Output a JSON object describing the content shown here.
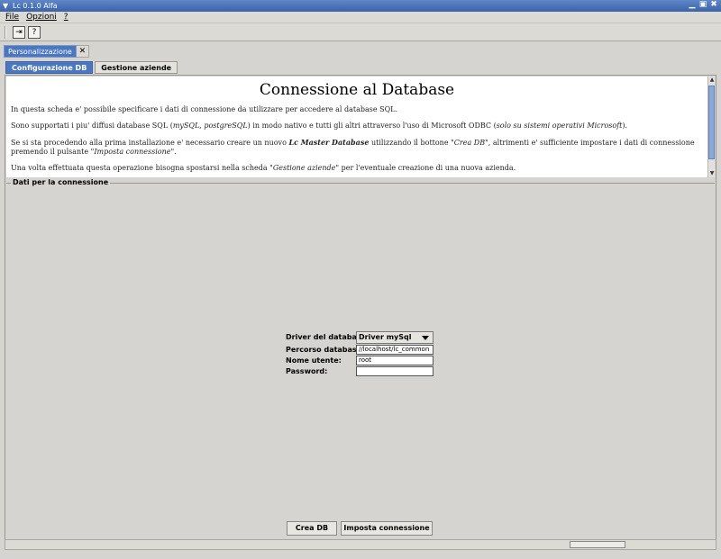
{
  "window": {
    "title": "Lc 0.1.0 Alfa"
  },
  "menu": {
    "file": "File",
    "opzioni": "Opzioni",
    "help": "?"
  },
  "toolbar": {
    "icon1": "new-window-icon",
    "icon2": "help-icon"
  },
  "outer_tab": {
    "label": "Personalizzazione",
    "close": "✕"
  },
  "inner_tabs": [
    {
      "label": "Configurazione DB",
      "active": true
    },
    {
      "label": "Gestione aziende",
      "active": false
    }
  ],
  "info": {
    "title": "Connessione al Database",
    "p1": "In questa scheda e' possibile specificare i dati di connessione da utilizzare per accedere al database SQL.",
    "p2_a": "Sono supportati i piu' diffusi database SQL (",
    "p2_b": "mySQL, postgreSQL",
    "p2_c": ") in modo nativo e tutti gli altri attraverso l'uso di Microsoft ODBC (",
    "p2_d": "solo su sistemi operativi Microsoft",
    "p2_e": ").",
    "p3_a": "Se si sta procedendo alla prima installazione e' necessario creare un nuovo ",
    "p3_b": "Lc Master Database",
    "p3_c": " utilizzando il bottone \"",
    "p3_d": "Crea DB",
    "p3_e": "\", altrimenti e' sufficiente impostare i dati di connessione premendo il pulsante \"",
    "p3_f": "Imposta connessione",
    "p3_g": "\".",
    "p4_a": "Una volta effettuata questa operazione bisogna spostarsi nella scheda \"",
    "p4_b": "Gestione aziende",
    "p4_c": "\" per l'eventuale creazione di una nuova azienda."
  },
  "connection": {
    "legend": "Dati per la connessione",
    "driver_label": "Driver del database:",
    "driver_value": "Driver mySql",
    "path_label": "Percorso database:",
    "path_value": "//localhost/lc_common",
    "user_label": "Nome utente:",
    "user_value": "root",
    "password_label": "Password:",
    "password_value": ""
  },
  "buttons": {
    "crea_db": "Crea DB",
    "imposta": "Imposta connessione"
  },
  "colors": {
    "accent": "#4b77c0",
    "titlebar": "#3a63a8"
  }
}
